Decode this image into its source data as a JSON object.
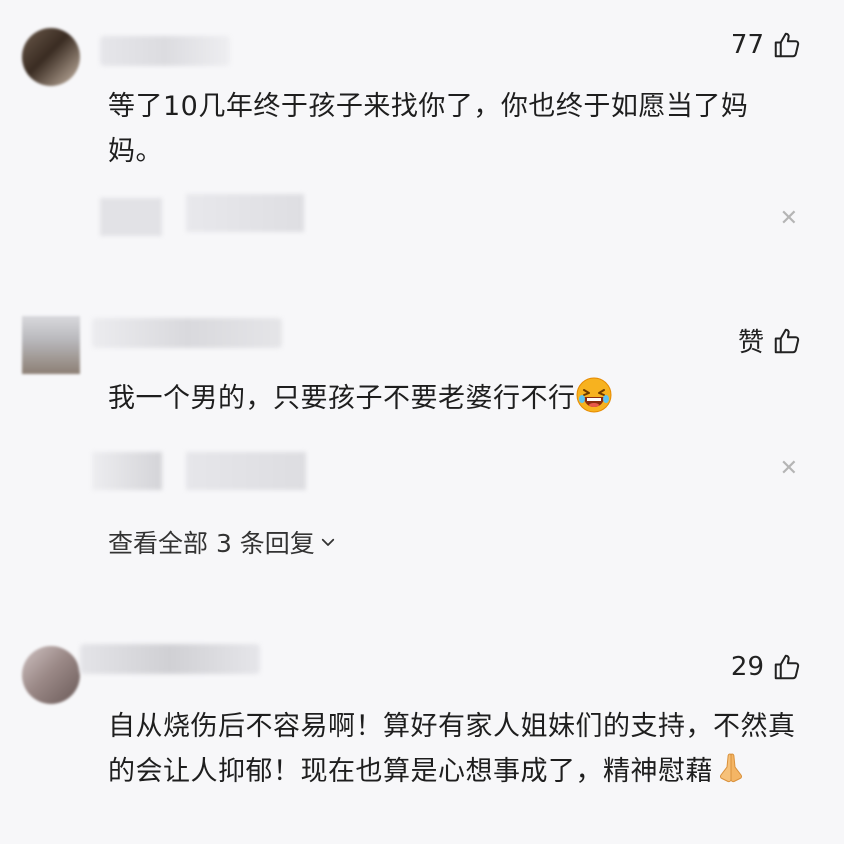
{
  "comments": [
    {
      "likes": "77",
      "text": "等了10几年终于孩子来找你了，你也终于如愿当了妈妈。"
    },
    {
      "likes": "赞",
      "text": "我一个男的，只要孩子不要老婆行不行",
      "emoji": "laughing-emoji",
      "view_replies": "查看全部 3 条回复"
    },
    {
      "likes": "29",
      "text": "自从烧伤后不容易啊！算好有家人姐妹们的支持，不然真的会让人抑郁！现在也算是心想事成了，精神慰藉",
      "emoji": "praying-hands-emoji"
    }
  ],
  "icons": {
    "like": "thumbs-up-icon",
    "close": "close-icon",
    "chevron": "chevron-down-icon"
  },
  "colors": {
    "background": "#f7f7f9",
    "text": "#1e1e1e",
    "muted": "#b5b5b5"
  }
}
